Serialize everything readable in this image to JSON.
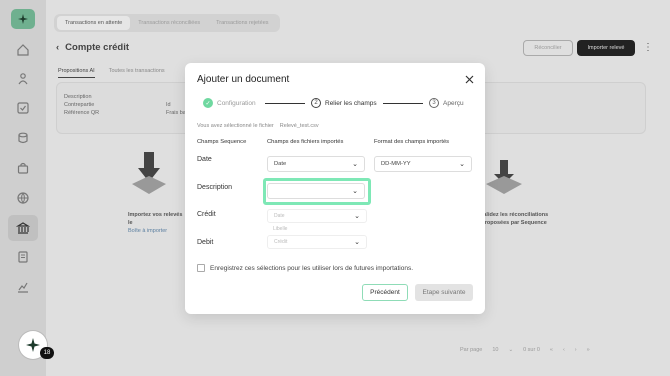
{
  "colors": {
    "accent": "#7ee8b6",
    "brand": "#6fb08f"
  },
  "sidebar": {
    "logo_icon": "sequence-logo-icon",
    "icons": [
      "home-icon",
      "people-icon",
      "check-square-icon",
      "coins-icon",
      "bag-icon",
      "globe-icon",
      "bank-icon",
      "document-icon",
      "chart-icon"
    ],
    "active_index": 6,
    "badge": "18"
  },
  "background": {
    "tabs": [
      "Transactions en attente",
      "Transactions réconciliées",
      "Transactions rejetées"
    ],
    "title": "Compte crédit",
    "reconcile_label": "Réconcilier",
    "import_label": "Importer relevé",
    "subtabs": [
      "Propositions AI",
      "Toutes les transactions"
    ],
    "fields": [
      "Description",
      "Contrepartie",
      "Référence QR"
    ],
    "fields2": [
      "Id",
      "Frais ba"
    ],
    "left_text_1": "Importez vos relevés",
    "left_text_2": "le",
    "left_link": "Boîte à importer",
    "right_text_1": "Validez les réconciliations",
    "right_text_2": "proposées par Sequence",
    "pager_label": "Par page",
    "pager_value": "10",
    "pager_range": "0 sur 0"
  },
  "modal": {
    "title": "Ajouter un document",
    "steps": [
      {
        "num": "✓",
        "label": "Configuration"
      },
      {
        "num": "2",
        "label": "Relier les champs"
      },
      {
        "num": "3",
        "label": "Aperçu"
      }
    ],
    "file_info_label": "Vous avez sélectionné le fichier",
    "file_name": "Relevé_test.csv",
    "headers": [
      "Champs Sequence",
      "Champs des fichiers importés",
      "Format des champs importés"
    ],
    "rows": [
      {
        "label": "Date",
        "value": "Date",
        "format": "DD-MM-YY"
      },
      {
        "label": "Description",
        "value": ""
      },
      {
        "label": "Crédit"
      },
      {
        "label": "Debit"
      }
    ],
    "dropdown_options": [
      "Date",
      "Libelle",
      "Crédit"
    ],
    "checkbox_label": "Enregistrez ces sélections pour les utiliser lors de futures importations.",
    "prev_label": "Précédent",
    "next_label": "Etape suivante"
  }
}
